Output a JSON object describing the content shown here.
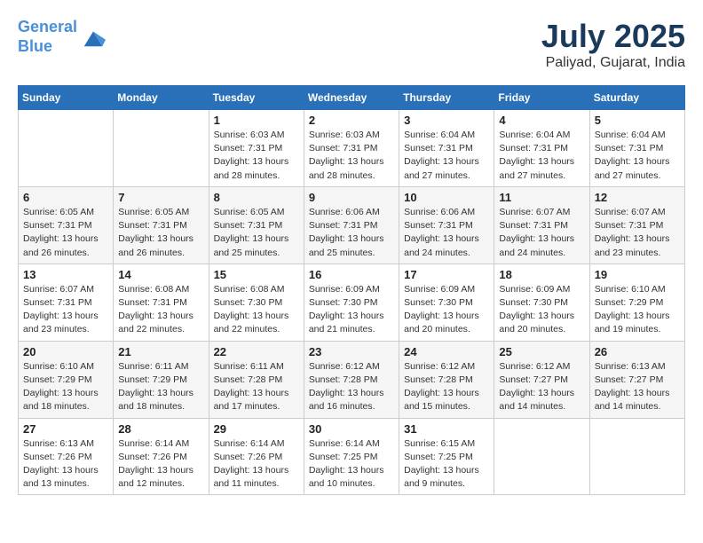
{
  "header": {
    "logo_line1": "General",
    "logo_line2": "Blue",
    "month_year": "July 2025",
    "location": "Paliyad, Gujarat, India"
  },
  "weekdays": [
    "Sunday",
    "Monday",
    "Tuesday",
    "Wednesday",
    "Thursday",
    "Friday",
    "Saturday"
  ],
  "weeks": [
    [
      {
        "day": "",
        "info": ""
      },
      {
        "day": "",
        "info": ""
      },
      {
        "day": "1",
        "info": "Sunrise: 6:03 AM\nSunset: 7:31 PM\nDaylight: 13 hours\nand 28 minutes."
      },
      {
        "day": "2",
        "info": "Sunrise: 6:03 AM\nSunset: 7:31 PM\nDaylight: 13 hours\nand 28 minutes."
      },
      {
        "day": "3",
        "info": "Sunrise: 6:04 AM\nSunset: 7:31 PM\nDaylight: 13 hours\nand 27 minutes."
      },
      {
        "day": "4",
        "info": "Sunrise: 6:04 AM\nSunset: 7:31 PM\nDaylight: 13 hours\nand 27 minutes."
      },
      {
        "day": "5",
        "info": "Sunrise: 6:04 AM\nSunset: 7:31 PM\nDaylight: 13 hours\nand 27 minutes."
      }
    ],
    [
      {
        "day": "6",
        "info": "Sunrise: 6:05 AM\nSunset: 7:31 PM\nDaylight: 13 hours\nand 26 minutes."
      },
      {
        "day": "7",
        "info": "Sunrise: 6:05 AM\nSunset: 7:31 PM\nDaylight: 13 hours\nand 26 minutes."
      },
      {
        "day": "8",
        "info": "Sunrise: 6:05 AM\nSunset: 7:31 PM\nDaylight: 13 hours\nand 25 minutes."
      },
      {
        "day": "9",
        "info": "Sunrise: 6:06 AM\nSunset: 7:31 PM\nDaylight: 13 hours\nand 25 minutes."
      },
      {
        "day": "10",
        "info": "Sunrise: 6:06 AM\nSunset: 7:31 PM\nDaylight: 13 hours\nand 24 minutes."
      },
      {
        "day": "11",
        "info": "Sunrise: 6:07 AM\nSunset: 7:31 PM\nDaylight: 13 hours\nand 24 minutes."
      },
      {
        "day": "12",
        "info": "Sunrise: 6:07 AM\nSunset: 7:31 PM\nDaylight: 13 hours\nand 23 minutes."
      }
    ],
    [
      {
        "day": "13",
        "info": "Sunrise: 6:07 AM\nSunset: 7:31 PM\nDaylight: 13 hours\nand 23 minutes."
      },
      {
        "day": "14",
        "info": "Sunrise: 6:08 AM\nSunset: 7:31 PM\nDaylight: 13 hours\nand 22 minutes."
      },
      {
        "day": "15",
        "info": "Sunrise: 6:08 AM\nSunset: 7:30 PM\nDaylight: 13 hours\nand 22 minutes."
      },
      {
        "day": "16",
        "info": "Sunrise: 6:09 AM\nSunset: 7:30 PM\nDaylight: 13 hours\nand 21 minutes."
      },
      {
        "day": "17",
        "info": "Sunrise: 6:09 AM\nSunset: 7:30 PM\nDaylight: 13 hours\nand 20 minutes."
      },
      {
        "day": "18",
        "info": "Sunrise: 6:09 AM\nSunset: 7:30 PM\nDaylight: 13 hours\nand 20 minutes."
      },
      {
        "day": "19",
        "info": "Sunrise: 6:10 AM\nSunset: 7:29 PM\nDaylight: 13 hours\nand 19 minutes."
      }
    ],
    [
      {
        "day": "20",
        "info": "Sunrise: 6:10 AM\nSunset: 7:29 PM\nDaylight: 13 hours\nand 18 minutes."
      },
      {
        "day": "21",
        "info": "Sunrise: 6:11 AM\nSunset: 7:29 PM\nDaylight: 13 hours\nand 18 minutes."
      },
      {
        "day": "22",
        "info": "Sunrise: 6:11 AM\nSunset: 7:28 PM\nDaylight: 13 hours\nand 17 minutes."
      },
      {
        "day": "23",
        "info": "Sunrise: 6:12 AM\nSunset: 7:28 PM\nDaylight: 13 hours\nand 16 minutes."
      },
      {
        "day": "24",
        "info": "Sunrise: 6:12 AM\nSunset: 7:28 PM\nDaylight: 13 hours\nand 15 minutes."
      },
      {
        "day": "25",
        "info": "Sunrise: 6:12 AM\nSunset: 7:27 PM\nDaylight: 13 hours\nand 14 minutes."
      },
      {
        "day": "26",
        "info": "Sunrise: 6:13 AM\nSunset: 7:27 PM\nDaylight: 13 hours\nand 14 minutes."
      }
    ],
    [
      {
        "day": "27",
        "info": "Sunrise: 6:13 AM\nSunset: 7:26 PM\nDaylight: 13 hours\nand 13 minutes."
      },
      {
        "day": "28",
        "info": "Sunrise: 6:14 AM\nSunset: 7:26 PM\nDaylight: 13 hours\nand 12 minutes."
      },
      {
        "day": "29",
        "info": "Sunrise: 6:14 AM\nSunset: 7:26 PM\nDaylight: 13 hours\nand 11 minutes."
      },
      {
        "day": "30",
        "info": "Sunrise: 6:14 AM\nSunset: 7:25 PM\nDaylight: 13 hours\nand 10 minutes."
      },
      {
        "day": "31",
        "info": "Sunrise: 6:15 AM\nSunset: 7:25 PM\nDaylight: 13 hours\nand 9 minutes."
      },
      {
        "day": "",
        "info": ""
      },
      {
        "day": "",
        "info": ""
      }
    ]
  ]
}
